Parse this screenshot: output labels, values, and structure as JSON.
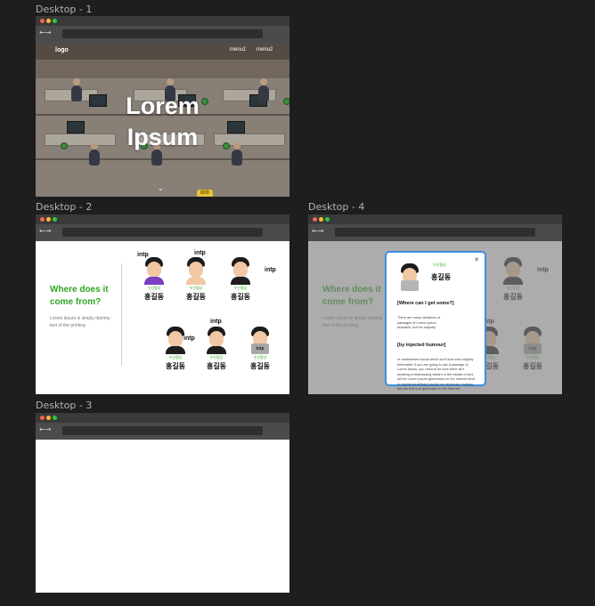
{
  "frames": {
    "d1": "Desktop - 1",
    "d2": "Desktop - 2",
    "d3": "Desktop - 3",
    "d4": "Desktop - 4"
  },
  "browser": {
    "nav_arrows": "←→"
  },
  "hero": {
    "logo": "logo",
    "menu1": "menu1",
    "menu2": "menu2",
    "title_line1": "Lorem",
    "title_line2": "Ipsum",
    "scroll_icon": "⌄",
    "badge": "800"
  },
  "about": {
    "headline_line1": "Where does it",
    "headline_line2": "come from?",
    "body": "Lorem Ipsum is simply dummy text of the printing"
  },
  "members": [
    {
      "tag": "intp",
      "role": "우선협상",
      "name": "홍길동"
    },
    {
      "tag": "intp",
      "role": "우선협상",
      "name": "홍길동"
    },
    {
      "tag": "intp",
      "role": "우선협상",
      "name": "홍길동"
    },
    {
      "tag": "intp",
      "role": "우선협상",
      "name": "홍길동"
    },
    {
      "tag": "intp",
      "role": "우선협상",
      "name": "홍길동"
    },
    {
      "tag": "intp",
      "role": "우선협상",
      "name": "홍길동"
    }
  ],
  "modal": {
    "close_icon": "✕",
    "role": "우선협상",
    "name": "홍길동",
    "heading1": "[Where can I get some?]",
    "para1": "There are many variations of passages of Lorem Ipsum available, but the majority",
    "heading2": "[by injected humour]",
    "para2": "or randomised words which don't look even slightly believable. If you are going to use a passage of Lorem Ipsum, you need to be sure there isn't anything embarrassing hidden in the middle of text. All the Lorem Ipsum generators on the Internet tend to repeat predefined chunks as necessary, making this the first true generator on the Internet."
  },
  "colors": {
    "accent_green": "#2ea620",
    "modal_border": "#3a8fe0",
    "canvas": "#1e1e1e"
  }
}
